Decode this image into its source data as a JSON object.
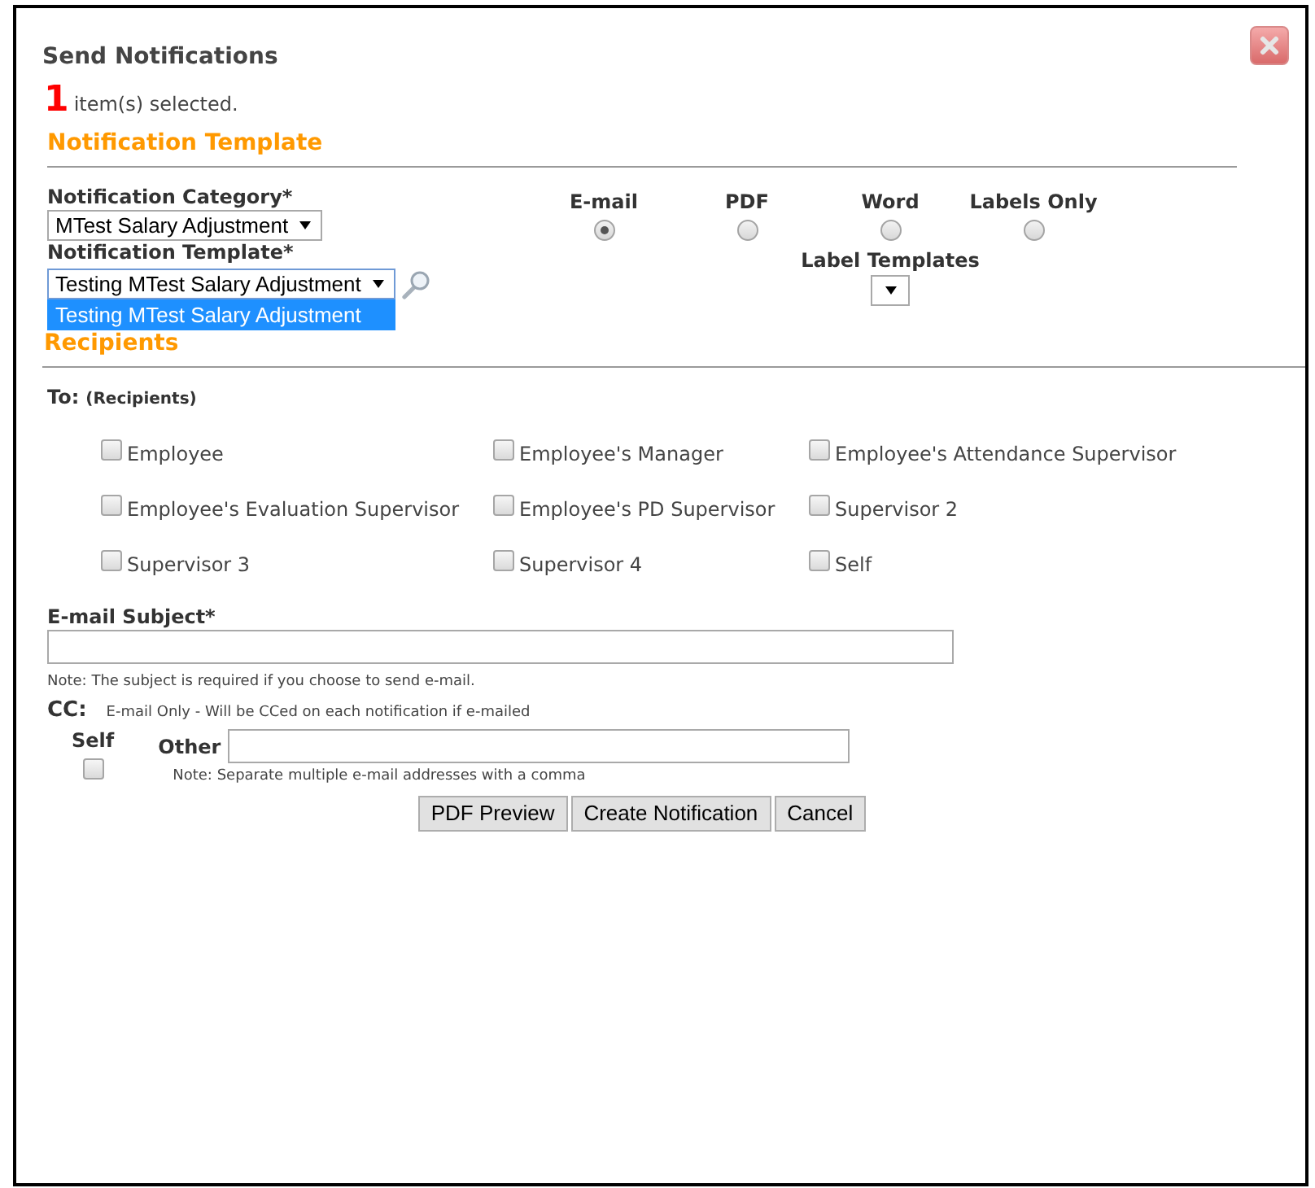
{
  "dialog": {
    "title": "Send Notifications"
  },
  "selection": {
    "count": "1",
    "text": "item(s) selected."
  },
  "template_section": {
    "heading": "Notification Template"
  },
  "category": {
    "label": "Notification Category*",
    "value": "MTest Salary Adjustment"
  },
  "template": {
    "label": "Notification Template*",
    "value": "Testing MTest Salary Adjustment",
    "expanded": true,
    "options": [
      {
        "label": "Testing MTest Salary Adjustment",
        "selected": true
      }
    ]
  },
  "formats": [
    {
      "label": "E-mail",
      "selected": true
    },
    {
      "label": "PDF",
      "selected": false
    },
    {
      "label": "Word",
      "selected": false
    },
    {
      "label": "Labels Only",
      "selected": false
    }
  ],
  "label_templates": {
    "label": "Label Templates"
  },
  "recipients_section": {
    "heading": "Recipients",
    "to_label": "To:",
    "to_hint": "(Recipients)"
  },
  "recipients": [
    {
      "label": "Employee",
      "checked": false
    },
    {
      "label": "Employee's Manager",
      "checked": false
    },
    {
      "label": "Employee's Attendance Supervisor",
      "checked": false
    },
    {
      "label": "Employee's Evaluation Supervisor",
      "checked": false
    },
    {
      "label": "Employee's PD Supervisor",
      "checked": false
    },
    {
      "label": "Supervisor 2",
      "checked": false
    },
    {
      "label": "Supervisor 3",
      "checked": false
    },
    {
      "label": "Supervisor 4",
      "checked": false
    },
    {
      "label": "Self",
      "checked": false
    }
  ],
  "email_subject": {
    "label": "E-mail Subject*",
    "note": "Note: The subject is required if you choose to send e-mail."
  },
  "cc": {
    "label": "CC:",
    "note": "E-mail Only - Will be CCed on each notification if e-mailed",
    "self": {
      "label": "Self",
      "checked": false
    },
    "other": {
      "label": "Other",
      "note": "Note: Separate multiple e-mail addresses with a comma"
    }
  },
  "buttons": [
    {
      "label": "PDF Preview"
    },
    {
      "label": "Create Notification"
    },
    {
      "label": "Cancel"
    }
  ]
}
